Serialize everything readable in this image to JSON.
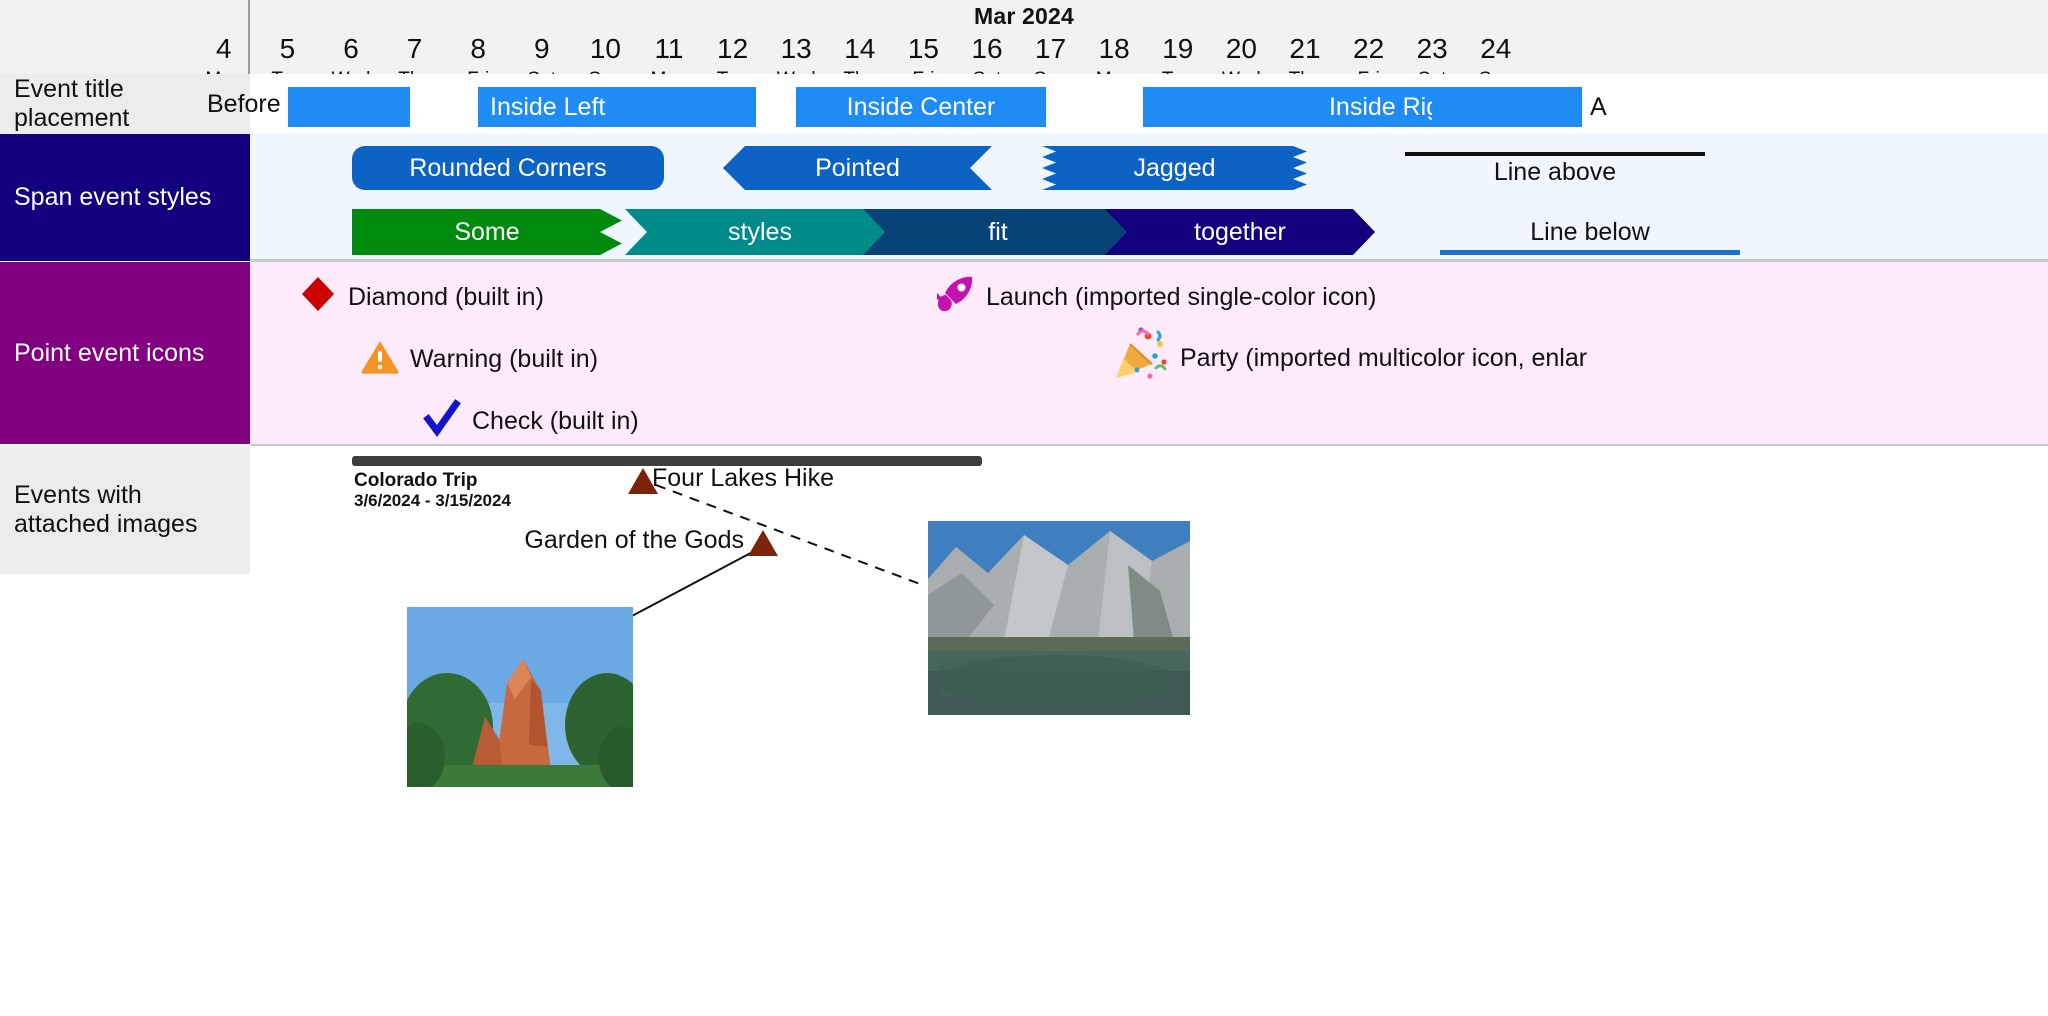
{
  "header": {
    "month_label": "Mar 2024",
    "days": [
      {
        "num": "4",
        "name": "Mon"
      },
      {
        "num": "5",
        "name": "Tue"
      },
      {
        "num": "6",
        "name": "Wed"
      },
      {
        "num": "7",
        "name": "Thu"
      },
      {
        "num": "8",
        "name": "Fri"
      },
      {
        "num": "9",
        "name": "Sat"
      },
      {
        "num": "10",
        "name": "Sun"
      },
      {
        "num": "11",
        "name": "Mon"
      },
      {
        "num": "12",
        "name": "Tue"
      },
      {
        "num": "13",
        "name": "Wed"
      },
      {
        "num": "14",
        "name": "Thu"
      },
      {
        "num": "15",
        "name": "Fri"
      },
      {
        "num": "16",
        "name": "Sat"
      },
      {
        "num": "17",
        "name": "Sun"
      },
      {
        "num": "18",
        "name": "Mon"
      },
      {
        "num": "19",
        "name": "Tue"
      },
      {
        "num": "20",
        "name": "Wed"
      },
      {
        "num": "21",
        "name": "Thu"
      },
      {
        "num": "22",
        "name": "Fri"
      },
      {
        "num": "23",
        "name": "Sat"
      },
      {
        "num": "24",
        "name": "Sun"
      }
    ]
  },
  "rows": {
    "title_placement": {
      "label": "Event title placement",
      "bars": [
        {
          "text": "Before",
          "placement": "before"
        },
        {
          "text": "Inside Left",
          "placement": "inside-left"
        },
        {
          "text": "Inside Center",
          "placement": "inside-center"
        },
        {
          "text": "Inside Right",
          "placement": "inside-right"
        },
        {
          "text": "A",
          "placement": "after"
        }
      ],
      "bar_color": "#1f8bf5"
    },
    "span_styles": {
      "label": "Span event styles",
      "label_bg": "#12007e",
      "band_bg": "#eff6fd",
      "shapes": [
        {
          "text": "Rounded Corners",
          "style": "rounded",
          "color": "#0c63c4"
        },
        {
          "text": "Pointed",
          "style": "pointed",
          "color": "#0c63c4"
        },
        {
          "text": "Jagged",
          "style": "jagged",
          "color": "#0c63c4"
        },
        {
          "text": "Line above",
          "style": "line-above",
          "color": "#111111"
        }
      ],
      "chevrons": [
        {
          "text": "Some",
          "color": "#008a0e"
        },
        {
          "text": "styles",
          "color": "#008b8b"
        },
        {
          "text": "fit",
          "color": "#084377"
        },
        {
          "text": "together",
          "color": "#12007e"
        }
      ],
      "line_below_text": "Line below",
      "line_below_color": "#1f6fd0"
    },
    "point_icons": {
      "label": "Point event icons",
      "label_bg": "#800080",
      "band_bg": "#fdeafb",
      "items": [
        {
          "icon": "diamond-icon",
          "text": "Diamond (built in)",
          "color": "#cc0000"
        },
        {
          "icon": "warning-icon",
          "text": "Warning (built in)",
          "color": "#f59426"
        },
        {
          "icon": "check-icon",
          "text": "Check (built in)",
          "color": "#1414cc"
        },
        {
          "icon": "rocket-icon",
          "text": "Launch (imported single-color icon)",
          "color": "#c412b0"
        },
        {
          "icon": "party-icon",
          "text": "Party (imported multicolor icon, enlar",
          "color": "#e8a33d"
        }
      ]
    },
    "attached_images": {
      "label": "Events with attached images",
      "trip": {
        "title": "Colorado Trip",
        "dates": "3/6/2024 - 3/15/2024",
        "bar_color": "#3d3d3d"
      },
      "points": [
        {
          "text": "Four Lakes Hike",
          "marker": "triangle-marker",
          "color": "#7b2409"
        },
        {
          "text": "Garden of the Gods",
          "marker": "triangle-marker",
          "color": "#7b2409"
        }
      ],
      "photos": [
        {
          "name": "garden-of-the-gods-photo"
        },
        {
          "name": "four-lakes-photo"
        }
      ]
    }
  }
}
